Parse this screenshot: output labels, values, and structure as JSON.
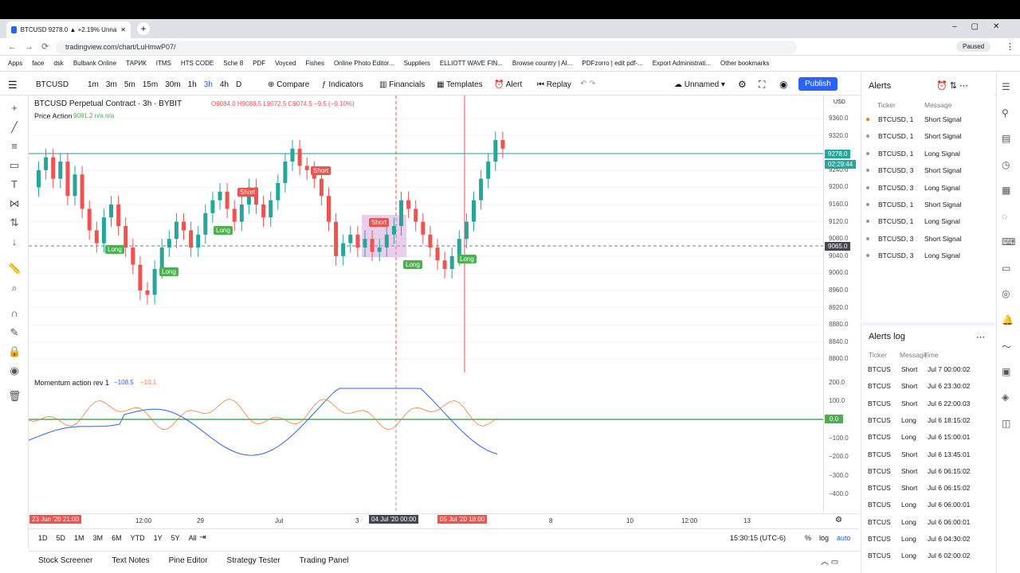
{
  "browser": {
    "tab_title": "BTCUSD 9278.0 ▲ +2.19% Unna",
    "url": "tradingview.com/chart/LuHmwP07/",
    "profile": "Paused",
    "bookmarks": [
      "Apps",
      "face",
      "dsk",
      "Bulbank Online",
      "ТАРИК",
      "ITMS",
      "HTS CODE",
      "Sche 8",
      "PDF",
      "Voyced",
      "Fishes",
      "Online Photo Editor...",
      "Suppliers",
      "ELLIOTT WAVE FIN...",
      "Browse country | AI...",
      "PDFzorro | edit pdf-...",
      "Export Administrati...",
      "Other bookmarks"
    ]
  },
  "toolbar": {
    "symbol": "BTCUSD",
    "intervals": [
      "1m",
      "3m",
      "5m",
      "15m",
      "30m",
      "1h",
      "3h",
      "4h",
      "D"
    ],
    "compare": "Compare",
    "indicators": "Indicators",
    "financials": "Financials",
    "templates": "Templates",
    "alert": "Alert",
    "replay": "Replay",
    "layout_name": "Unnamed",
    "publish": "Publish"
  },
  "chart": {
    "title": "BTCUSD Perpetual Contract · 3h · BYBIT",
    "ohlc": "O9084.0 H9088.5 L9072.5 C9074.5 −9.5 (−0.10%)",
    "indicator": "Price Action",
    "indicator_vals": "9081.2 n/a n/a",
    "currency": "USD",
    "price_ticks": [
      "9360.0",
      "9320.0",
      "9280.0",
      "9240.0",
      "9200.0",
      "9160.0",
      "9120.0",
      "9080.0",
      "9040.0",
      "9000.0",
      "8960.0",
      "8920.0",
      "8880.0",
      "8840.0",
      "8800.0"
    ],
    "last_price": "9278.0",
    "countdown": "02:29:44",
    "cursor_price": "9065.0",
    "signals": [
      {
        "t": "Long"
      },
      {
        "t": "Long"
      },
      {
        "t": "Long"
      },
      {
        "t": "Short"
      },
      {
        "t": "Short"
      },
      {
        "t": "Short"
      },
      {
        "t": "Long"
      },
      {
        "t": "Long"
      }
    ]
  },
  "oscillator": {
    "title": "Momentum action rev 1",
    "v1": "−108.5",
    "v2": "−10.1",
    "ticks": [
      "200.0",
      "100.0",
      "0.0",
      "−100.0",
      "−200.0",
      "−300.0",
      "−400.0"
    ],
    "zero_label": "0.0"
  },
  "time_axis": {
    "labels": [
      "12:00",
      "29",
      "Jul",
      "3",
      "8",
      "10",
      "12:00",
      "13"
    ],
    "marker1": "23 Jun '20  21:00",
    "marker2": "04 Jul '20  00:00",
    "marker3": "05 Jul '20  18:00"
  },
  "ranges": [
    "1D",
    "5D",
    "1M",
    "3M",
    "6M",
    "YTD",
    "1Y",
    "5Y",
    "All"
  ],
  "clock": "15:30:15 (UTC-6)",
  "scale_opts": [
    "%",
    "log",
    "auto"
  ],
  "bottom_tabs": [
    "Stock Screener",
    "Text Notes",
    "Pine Editor",
    "Strategy Tester",
    "Trading Panel"
  ],
  "alerts": {
    "title": "Alerts",
    "col1": "Ticker",
    "col2": "Message",
    "rows": [
      [
        "BTCUSD, 1",
        "Short Signal"
      ],
      [
        "BTCUSD, 1",
        "Short Signal"
      ],
      [
        "BTCUSD, 1",
        "Long Signal"
      ],
      [
        "BTCUSD, 3",
        "Short Signal"
      ],
      [
        "BTCUSD, 3",
        "Long Signal"
      ],
      [
        "BTCUSD, 1",
        "Short Signal"
      ],
      [
        "BTCUSD, 1",
        "Long Signal"
      ],
      [
        "BTCUSD, 3",
        "Short Signal"
      ],
      [
        "BTCUSD, 3",
        "Long Signal"
      ]
    ]
  },
  "alerts_log": {
    "title": "Alerts log",
    "col1": "Ticker",
    "col2": "Message",
    "col3": "Time",
    "rows": [
      [
        "BTCUS",
        "Short",
        "Jul 7 00:00:02"
      ],
      [
        "BTCUS",
        "Short",
        "Jul 6 23:30:02"
      ],
      [
        "BTCUS",
        "Short",
        "Jul 6 22:00:03"
      ],
      [
        "BTCUS",
        "Long",
        "Jul 6 18:15:02"
      ],
      [
        "BTCUS",
        "Long",
        "Jul 6 15:00:01"
      ],
      [
        "BTCUS",
        "Short",
        "Jul 6 13:45:01"
      ],
      [
        "BTCUS",
        "Short",
        "Jul 6 06:15:02"
      ],
      [
        "BTCUS",
        "Short",
        "Jul 6 06:15:02"
      ],
      [
        "BTCUS",
        "Long",
        "Jul 6 06:00:01"
      ],
      [
        "BTCUS",
        "Long",
        "Jul 6 06:00:01"
      ],
      [
        "BTCUS",
        "Long",
        "Jul 6 04:30:02"
      ],
      [
        "BTCUS",
        "Long",
        "Jul 6 02:00:02"
      ]
    ]
  }
}
